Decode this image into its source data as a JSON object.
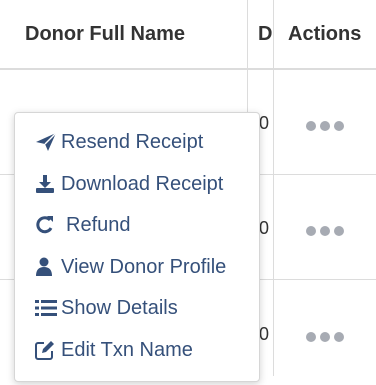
{
  "table": {
    "headers": {
      "donor_full_name": "Donor Full Name",
      "d_truncated": "D",
      "actions": "Actions"
    },
    "rows": [
      {
        "truncated_value": "0"
      },
      {
        "truncated_value": "0"
      },
      {
        "truncated_value": "0"
      }
    ]
  },
  "action_menu": {
    "items": [
      {
        "label": "Resend Receipt",
        "icon": "paper-plane-icon"
      },
      {
        "label": "Download Receipt",
        "icon": "download-icon"
      },
      {
        "label": "Refund",
        "icon": "refresh-icon"
      },
      {
        "label": "View Donor Profile",
        "icon": "user-icon"
      },
      {
        "label": "Show Details",
        "icon": "list-icon"
      },
      {
        "label": "Edit Txn Name",
        "icon": "edit-icon"
      }
    ]
  },
  "colors": {
    "menu_text": "#35507a",
    "dots": "#a7abb3",
    "grid": "#dcdcdc"
  }
}
